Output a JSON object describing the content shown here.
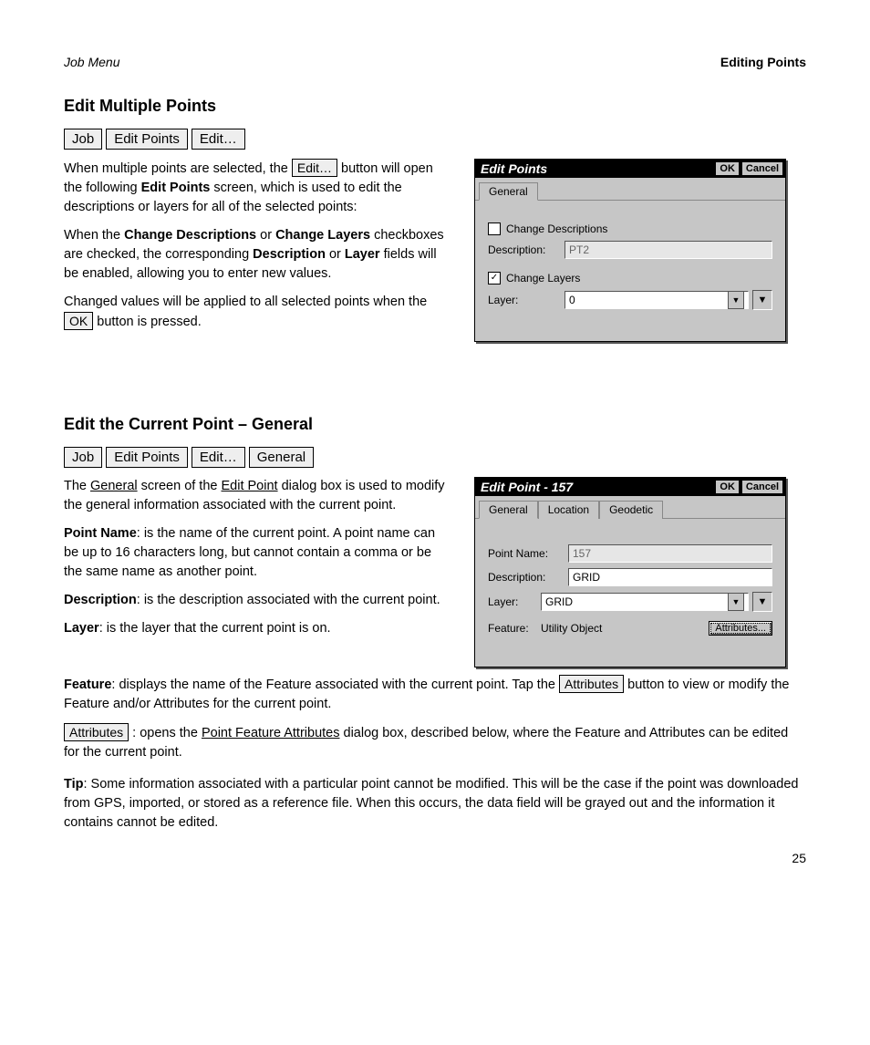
{
  "header": {
    "left": "Job Menu",
    "right": "Editing Points"
  },
  "section1": {
    "heading": "Edit Multiple Points",
    "breadcrumbs": [
      "Job",
      "Edit Points",
      "Edit…"
    ],
    "para1_pre": "When multiple points are selected, the ",
    "para1_crumb": "Edit…",
    "para1_post": " button will open the following ",
    "para1_tail": " screen, which is used to edit the descriptions or layers for all of the selected points:",
    "edit_points_bold": "Edit Points",
    "para2_pre": "When the ",
    "para2_b1": "Change Descriptions",
    "para2_mid1": " or ",
    "para2_b2": "Change Layers",
    "para2_mid2": " checkboxes are checked, the corresponding ",
    "para2_b3": "Description",
    "para2_mid3": " or ",
    "para2_b4": "Layer",
    "para2_mid4": " fields will be enabled, allowing you to enter new values.",
    "para3_pre": "Changed values will be applied to all selected points when the ",
    "para3_btn": "OK",
    "para3_post": " button is pressed."
  },
  "dialog1": {
    "title": "Edit Points",
    "ok": "OK",
    "cancel": "Cancel",
    "tab": "General",
    "change_desc_label": "Change Descriptions",
    "desc_label": "Description:",
    "desc_value": "PT2",
    "change_layers_label": "Change Layers",
    "layer_label": "Layer:",
    "layer_value": "0",
    "check_mark": "✓"
  },
  "section2": {
    "heading": "Edit the Current Point – General",
    "breadcrumbs": [
      "Job",
      "Edit Points",
      "Edit…",
      "General"
    ],
    "l1_pre": "The ",
    "l1_u1": "General",
    "l1_mid": " screen of the ",
    "l1_u2": "Edit Point",
    "l1_post": " dialog box is used to modify the general information associated with the current point.",
    "b1": "Point Name",
    "b1_txt": ": is the name of the current point. A point name can be up to 16 characters long, but cannot contain a comma or be the same name as another point.",
    "b2": "Description",
    "b2_txt": ": is the description associated with the current point.",
    "b3": "Layer",
    "b3_txt": ": is the layer that the current point is on.",
    "b4": "Feature",
    "b4_txt": ": displays the name of the Feature associated with the current point. Tap the ",
    "b4_crumb": "Attributes",
    "b4_txt2": " button to view or modify the Feature and/or Attributes for the current point.",
    "attr_crumb": "Attributes",
    "attr_txt_pre": ": opens the ",
    "attr_u": "Point Feature Attributes",
    "attr_txt_post": " dialog box, described below, where the Feature and Attributes can be edited for the current point.",
    "attr_label": "Attributes",
    "tip_b": "Tip",
    "tip_txt": ": Some information associated with a particular point cannot be modified. This will be the case if the point was downloaded from GPS, imported, or stored as a reference file. When this occurs, the data field will be grayed out and the information it contains cannot be edited."
  },
  "dialog2": {
    "title": "Edit Point - 157",
    "ok": "OK",
    "cancel": "Cancel",
    "tabs": [
      "General",
      "Location",
      "Geodetic"
    ],
    "pn_label": "Point Name:",
    "pn_value": "157",
    "desc_label": "Description:",
    "desc_value": "GRID",
    "layer_label": "Layer:",
    "layer_value": "GRID",
    "feat_label": "Feature:",
    "feat_value": "Utility Object",
    "attr_btn": "Attributes..."
  },
  "footer": {
    "page": "25"
  }
}
